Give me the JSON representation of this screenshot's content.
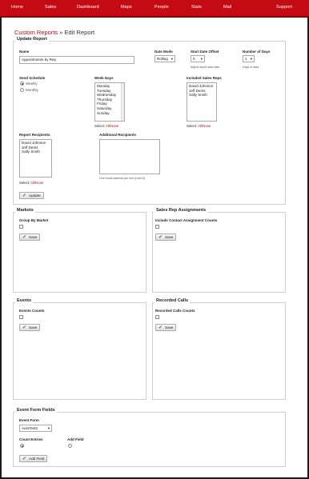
{
  "nav": [
    "Home",
    "Sales",
    "Dashboard",
    "Maps",
    "People",
    "Stats",
    "Mail",
    "Support"
  ],
  "breadcrumb": {
    "link": "Custom Reports",
    "sep": "»",
    "current": "Edit Report"
  },
  "update_report": {
    "legend": "Update Report",
    "name_label": "Name",
    "name_value": "Appointments by Rep",
    "date_mode_label": "Date Mode",
    "date_mode_value": "Rolling",
    "start_offset_label": "Start Date Offset",
    "start_offset_value": "0",
    "start_offset_hint": "Adjust report start date",
    "num_days_label": "Number of Days",
    "num_days_value": "1",
    "num_days_hint": "Days of data",
    "send_schedule_label": "Send Schedule",
    "schedule_weekly": "Weekly",
    "schedule_monthly": "Monthly",
    "week_days_label": "Week Days",
    "week_days": [
      "Monday",
      "Tuesday",
      "Wednesday",
      "Thursday",
      "Friday",
      "Saturday",
      "Sunday"
    ],
    "included_reps_label": "Included Sales Reps",
    "reps": [
      "David Johnson",
      "Jeff Dems",
      "Sally Smith"
    ],
    "recipients_label": "Report Recipients",
    "recipients": [
      "David Johnson",
      "Jeff Dems",
      "Sally Smith"
    ],
    "additional_label": "Additional Recipients",
    "additional_hint": "One email address per line (Limit 5)",
    "select_prefix": "Select:",
    "select_all": "All",
    "select_sep": "/",
    "select_none": "None",
    "update_button": "Update"
  },
  "markets": {
    "legend": "Markets",
    "field_label": "Group By Market",
    "save": "Save"
  },
  "sales_rep_assignments": {
    "legend": "Sales Rep Assignments",
    "field_label": "Include Contact Assignment Counts",
    "save": "Save"
  },
  "events": {
    "legend": "Events",
    "field_label": "Events Counts",
    "save": "Save"
  },
  "recorded_calls": {
    "legend": "Recorded Calls",
    "field_label": "Recorded Calls Counts",
    "save": "Save"
  },
  "event_form_fields": {
    "legend": "Event Form Fields",
    "form_label": "Event Form",
    "form_value": "AutoTest2",
    "count_label": "Count Entries",
    "add_label": "Add Field",
    "add_button": "Add Field"
  },
  "colors": {
    "nav_bg": "#c40b14",
    "link": "#b01018",
    "button_icon": "#2e8b2e"
  }
}
